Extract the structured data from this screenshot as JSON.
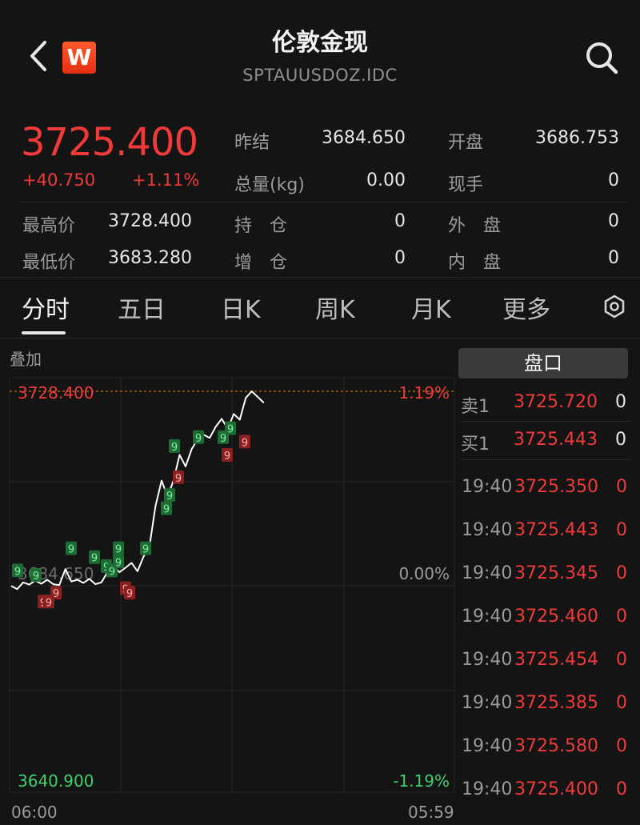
{
  "header": {
    "back_icon": "chevron-left-icon",
    "logo_text": "W",
    "title": "伦敦金现",
    "subtitle": "SPTAUUSDOZ.IDC",
    "search_icon": "search-icon"
  },
  "quote": {
    "price": "3725.400",
    "change": "+40.750",
    "change_pct": "+1.11%",
    "fields": {
      "prev_close_label": "昨结",
      "prev_close": "3684.650",
      "open_label": "开盘",
      "open": "3686.753",
      "volume_label": "总量(kg)",
      "volume": "0.00",
      "cur_hand_label": "现手",
      "cur_hand": "0",
      "high_label": "最高价",
      "high": "3728.400",
      "position_label": "持　仓",
      "position": "0",
      "outer_label": "外　盘",
      "outer": "0",
      "low_label": "最低价",
      "low": "3683.280",
      "pos_add_label": "增　仓",
      "pos_add": "0",
      "inner_label": "内　盘",
      "inner": "0"
    }
  },
  "tabs": [
    "分时",
    "五日",
    "日K",
    "周K",
    "月K",
    "更多"
  ],
  "active_tab": "分时",
  "settings_icon": "hexagon-gear-icon",
  "chart": {
    "overlay_label": "叠加",
    "top_price": "3728.400",
    "top_pct": "1.19%",
    "mid_price": "3684.650",
    "mid_pct": "0.00%",
    "bottom_price": "3640.900",
    "bottom_pct": "-1.19%",
    "time_start": "06:00",
    "time_end": "05:59",
    "marker_label": "9"
  },
  "chart_data": {
    "type": "line",
    "xlabel": "",
    "ylabel": "",
    "ylim": [
      3640.9,
      3728.4
    ],
    "x_range": [
      "06:00",
      "05:59"
    ],
    "reference_price": 3684.65,
    "series": [
      {
        "values": [
          3684.6,
          3683.9,
          3685.4,
          3684.9,
          3685.8,
          3685.1,
          3686.0,
          3685.0,
          3684.8,
          3688.4,
          3685.6,
          3686.0,
          3685.3,
          3686.2,
          3685.0,
          3685.4,
          3687.7,
          3689.1,
          3687.7,
          3688.7,
          3689.8,
          3687.9,
          3691.2,
          3693.6,
          3702.6,
          3708.3,
          3704.7,
          3708.4,
          3714.1,
          3711.5,
          3715.4,
          3717.6,
          3718.6,
          3717.9,
          3720.4,
          3722.2,
          3720.0,
          3723.3,
          3722.0,
          3726.9,
          3728.4,
          3727.1,
          3725.8
        ]
      }
    ],
    "green_markers_y": [
      3688,
      3687,
      3693,
      3691,
      3689,
      3688,
      3690,
      3693,
      3693,
      3702,
      3705,
      3716,
      3718,
      3718,
      3720
    ],
    "red_markers_y": [
      3681,
      3681,
      3683,
      3684,
      3683,
      3709,
      3714,
      3717
    ],
    "colors": {
      "line": "#ffffff",
      "up": "#f03a3a",
      "down": "#3fcf6d",
      "ref": "#a0a0a0",
      "high": "#e38a3a"
    }
  },
  "order_book": {
    "title": "盘口",
    "rows": [
      {
        "label": "卖1",
        "price": "3725.720",
        "qty": "0"
      },
      {
        "label": "买1",
        "price": "3725.443",
        "qty": "0"
      }
    ]
  },
  "ticks": [
    {
      "time": "19:40",
      "price": "3725.350",
      "qty": "0"
    },
    {
      "time": "19:40",
      "price": "3725.443",
      "qty": "0"
    },
    {
      "time": "19:40",
      "price": "3725.345",
      "qty": "0"
    },
    {
      "time": "19:40",
      "price": "3725.460",
      "qty": "0"
    },
    {
      "time": "19:40",
      "price": "3725.454",
      "qty": "0"
    },
    {
      "time": "19:40",
      "price": "3725.385",
      "qty": "0"
    },
    {
      "time": "19:40",
      "price": "3725.580",
      "qty": "0"
    },
    {
      "time": "19:40",
      "price": "3725.400",
      "qty": "0"
    }
  ]
}
